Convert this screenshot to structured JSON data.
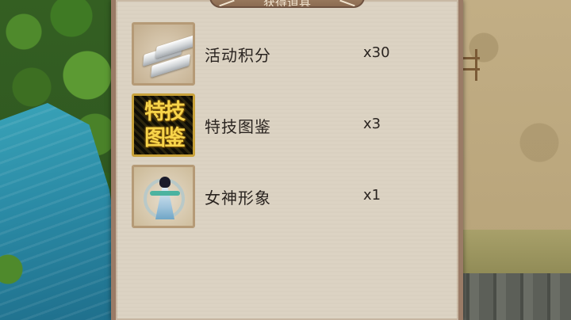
{
  "panel": {
    "title": "获得道具",
    "items": [
      {
        "name": "活动积分",
        "qty": "x30",
        "icon": "silver-ingot-icon"
      },
      {
        "name": "特技图鉴",
        "qty": "x3",
        "icon": "skill-book-icon",
        "icon_text": "特技图鉴"
      },
      {
        "name": "女神形象",
        "qty": "x1",
        "icon": "goddess-avatar-icon"
      }
    ]
  },
  "colors": {
    "panel_bg": "#dcd3c3",
    "panel_border": "#9a7b66",
    "skill_gold": "#f7d44a"
  }
}
